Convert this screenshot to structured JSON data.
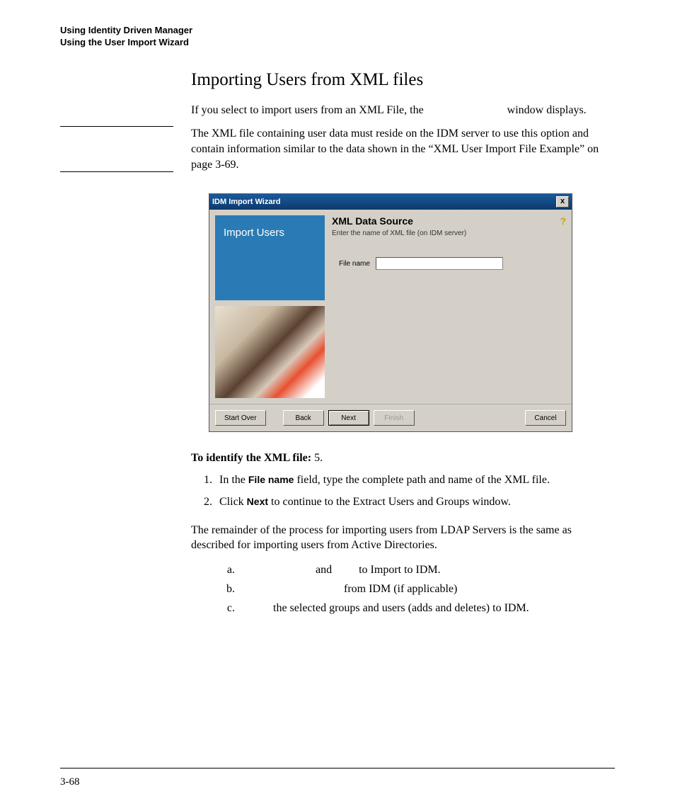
{
  "header": {
    "line1": "Using Identity Driven Manager",
    "line2": "Using the User Import Wizard"
  },
  "section": {
    "title": "Importing Users from XML files",
    "para1_a": "If you select to import users from an XML File, the ",
    "para1_b": " window displays.",
    "note": "The XML file containing user data must reside on the IDM server to use this option and contain information similar to the data shown in the “XML User Import File Example” on page 3-69."
  },
  "wizard": {
    "title": "IDM Import Wizard",
    "close": "x",
    "left_title": "Import Users",
    "heading": "XML Data Source",
    "sub": "Enter the name of XML file (on IDM server)",
    "field_label": "File name",
    "field_value": "",
    "help": "?",
    "buttons": {
      "start_over": "Start Over",
      "back": "Back",
      "next": "Next",
      "finish": "Finish",
      "cancel": "Cancel"
    }
  },
  "instructions": {
    "lead_bold": "To identify the XML file:",
    "lead_tail": " 5.",
    "step1_a": "In the ",
    "step1_bold": "File name",
    "step1_b": " field, type the complete path and name of the XML file.",
    "step2_a": "Click ",
    "step2_bold": "Next",
    "step2_b": " to continue to the Extract Users and Groups window.",
    "remainder": "The remainder of the process for importing users from LDAP Servers is the same as described for importing users from Active Directories.",
    "sub_a_mid": " and ",
    "sub_a_tail": " to Import to IDM.",
    "sub_b_tail": " from IDM (if applicable)",
    "sub_c_tail": " the selected groups and users (adds and deletes) to IDM."
  },
  "footer": {
    "page": "3-68"
  }
}
